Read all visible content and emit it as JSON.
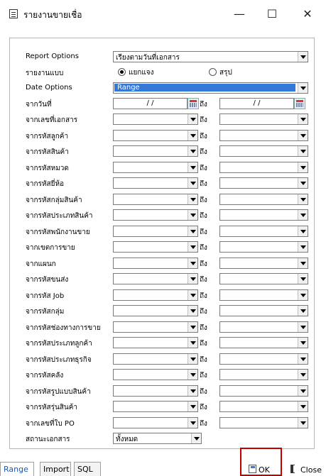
{
  "window": {
    "title": "รายงานขายเชื่อ",
    "minimize_glyph": "—",
    "maximize_glyph": "☐",
    "close_glyph": "✕"
  },
  "report_options": {
    "label": "Report Options",
    "value": "เรียงตามวันที่เอกสาร"
  },
  "report_type": {
    "label": "รายงานแบบ",
    "options": [
      "แยกแจง",
      "สรุป"
    ],
    "selected": 0
  },
  "date_options": {
    "label": "Date Options",
    "value": "Range"
  },
  "from_date": {
    "label": "จากวันที่",
    "from": "/ /",
    "to_label": "ถึง",
    "to": "/ /"
  },
  "ranges": [
    {
      "label": "จากเลขที่เอกสาร",
      "to_label": "ถึง"
    },
    {
      "label": "จากรหัสลูกค้า",
      "to_label": "ถึง"
    },
    {
      "label": "จากรหัสสินค้า",
      "to_label": "ถึง"
    },
    {
      "label": "จากรหัสหมวด",
      "to_label": "ถึง"
    },
    {
      "label": "จากรหัสยี่ห้อ",
      "to_label": "ถึง"
    },
    {
      "label": "จากรหัสกลุ่มสินค้า",
      "to_label": "ถึง"
    },
    {
      "label": "จากรหัสประเภทสินค้า",
      "to_label": "ถึง"
    },
    {
      "label": "จากรหัสพนักงานขาย",
      "to_label": "ถึง"
    },
    {
      "label": "จากเขตการขาย",
      "to_label": "ถึง"
    },
    {
      "label": "จากแผนก",
      "to_label": "ถึง"
    },
    {
      "label": "จากรหัสขนส่ง",
      "to_label": "ถึง"
    },
    {
      "label": "จากรหัส Job",
      "to_label": "ถึง"
    },
    {
      "label": "จากรหัสกลุ่ม",
      "to_label": "ถึง"
    },
    {
      "label": "จากรหัสช่องทางการขาย",
      "to_label": "ถึง"
    },
    {
      "label": "จากรหัสประเภทลูกค้า",
      "to_label": "ถึง"
    },
    {
      "label": "จากรหัสประเภทธุรกิจ",
      "to_label": "ถึง"
    },
    {
      "label": "จากรหัสคลัง",
      "to_label": "ถึง"
    },
    {
      "label": "จากรหัสรูปแบบสินค้า",
      "to_label": "ถึง"
    },
    {
      "label": "จากรหัสรุ่นสินค้า",
      "to_label": "ถึง"
    },
    {
      "label": "จากเลขที่ใบ PO",
      "to_label": "ถึง"
    }
  ],
  "doc_status": {
    "label": "สถานะเอกสาร",
    "value": "ทั้งหมด"
  },
  "tabs": [
    "Range",
    "Import",
    "SQL"
  ],
  "buttons": {
    "ok": "OK",
    "close": "Close"
  }
}
